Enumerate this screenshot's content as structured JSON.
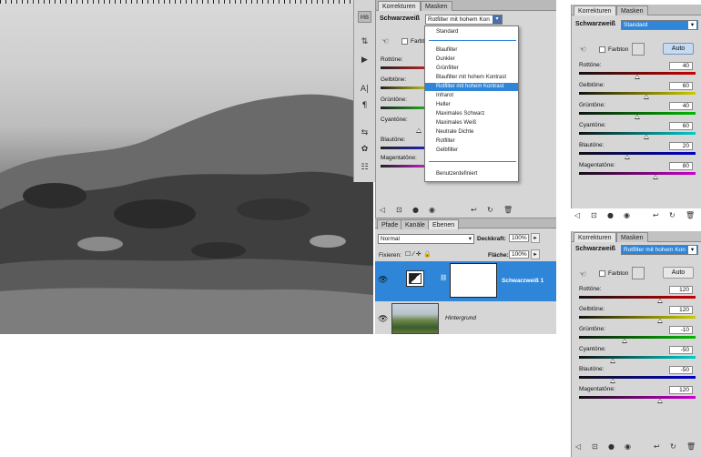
{
  "middle_panel": {
    "tabs": [
      "Korrekturen",
      "Masken"
    ],
    "title": "Schwarzweiß",
    "preset_value": "Rotfilter mit hohem Kon",
    "farbton_label": "Farbton",
    "sliders": [
      {
        "label": "Rottöne:"
      },
      {
        "label": "Gelbtöne:"
      },
      {
        "label": "Grüntöne:"
      },
      {
        "label": "Cyantöne:"
      },
      {
        "label": "Blautöne:"
      },
      {
        "label": "Magentatöne:"
      }
    ]
  },
  "dropdown": {
    "items": [
      "Standard",
      "Blaufilter",
      "Dunkler",
      "Grünfilter",
      "Blaufilter mit hohem Kontrast",
      "Rotfilter mit hohem Kontrast",
      "Infrarot",
      "Heller",
      "Maximales Schwarz",
      "Maximales Weiß",
      "Neutrale Dichte",
      "Rotfilter",
      "Gelbfilter",
      "Benutzerdefiniert"
    ],
    "selected": "Rotfilter mit hohem Kontrast"
  },
  "layers_panel": {
    "tabs": [
      "Pfade",
      "Kanäle",
      "Ebenen"
    ],
    "blend_mode": "Normal",
    "opacity_label": "Deckkraft:",
    "opacity_value": "100%",
    "lock_label": "Fixieren:",
    "fill_label": "Fläche:",
    "fill_value": "100%",
    "layers": [
      {
        "name": "Schwarzweiß 1",
        "selected": true
      },
      {
        "name": "Hintergrund",
        "selected": false
      }
    ]
  },
  "right_top_panel": {
    "tabs": [
      "Korrekturen",
      "Masken"
    ],
    "title": "Schwarzweiß",
    "preset_value": "Standard",
    "farbton_label": "Farbton",
    "auto_label": "Auto",
    "sliders": [
      {
        "label": "Rottöne:",
        "value": "40",
        "pos": 0.52
      },
      {
        "label": "Gelbtöne:",
        "value": "60",
        "pos": 0.6
      },
      {
        "label": "Grüntöne:",
        "value": "40",
        "pos": 0.52
      },
      {
        "label": "Cyantöne:",
        "value": "60",
        "pos": 0.6
      },
      {
        "label": "Blautöne:",
        "value": "20",
        "pos": 0.44
      },
      {
        "label": "Magentatöne:",
        "value": "80",
        "pos": 0.68
      }
    ]
  },
  "right_bottom_panel": {
    "tabs": [
      "Korrekturen",
      "Masken"
    ],
    "title": "Schwarzweiß",
    "preset_value": "Rotfilter mit hohem Kon",
    "farbton_label": "Farbton",
    "auto_label": "Auto",
    "sliders": [
      {
        "label": "Rottöne:",
        "value": "120",
        "pos": 0.72
      },
      {
        "label": "Gelbtöne:",
        "value": "120",
        "pos": 0.72
      },
      {
        "label": "Grüntöne:",
        "value": "-10",
        "pos": 0.4
      },
      {
        "label": "Cyantöne:",
        "value": "-50",
        "pos": 0.3
      },
      {
        "label": "Blautöne:",
        "value": "-50",
        "pos": 0.3
      },
      {
        "label": "Magentatöne:",
        "value": "120",
        "pos": 0.72
      }
    ]
  }
}
